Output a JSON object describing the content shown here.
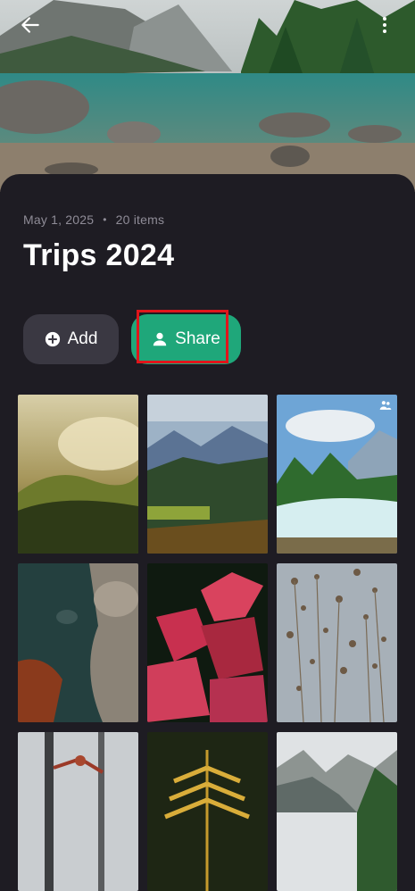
{
  "album": {
    "date": "May 1, 2025",
    "separator": "•",
    "count": "20 items",
    "title": "Trips 2024"
  },
  "actions": {
    "add_label": "Add",
    "share_label": "Share"
  },
  "icons": {
    "back": "back-arrow-icon",
    "more": "more-vertical-icon",
    "add": "plus-circle-icon",
    "share": "person-icon",
    "shared": "people-icon"
  },
  "colors": {
    "background": "#1e1c23",
    "add_button": "#3a3842",
    "share_button": "#1fa77a",
    "highlight": "#e0151b",
    "meta_text": "#8f8c97"
  },
  "photos": [
    {
      "subject": "misty hills sunrise"
    },
    {
      "subject": "mountain valley autumn"
    },
    {
      "subject": "river rapids forest",
      "shared": true
    },
    {
      "subject": "rocky coastline"
    },
    {
      "subject": "red leaves"
    },
    {
      "subject": "dried wildflowers"
    },
    {
      "subject": "foggy forest branches"
    },
    {
      "subject": "fern leaf"
    },
    {
      "subject": "mountain ridge"
    }
  ]
}
